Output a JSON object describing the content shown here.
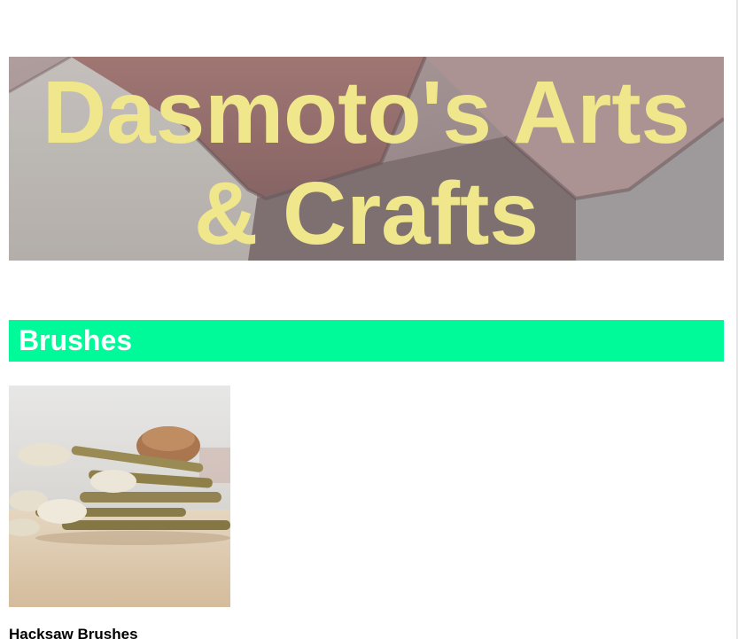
{
  "header": {
    "title": "Dasmoto's Arts & Crafts"
  },
  "sections": [
    {
      "heading": "Brushes",
      "heading_bg_color": "#00fa9a",
      "products": [
        {
          "name": "Hacksaw Brushes"
        }
      ]
    }
  ],
  "colors": {
    "title_text": "#f0e68c",
    "heading_text": "#ffffff",
    "background": "#ffffff"
  }
}
